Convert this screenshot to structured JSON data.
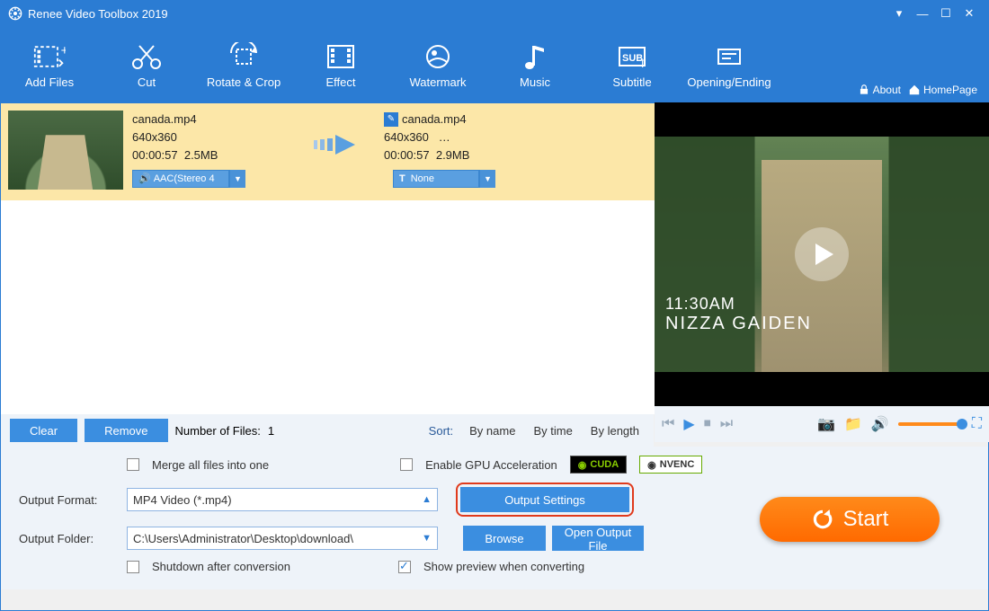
{
  "app": {
    "title": "Renee Video Toolbox 2019"
  },
  "header_links": {
    "about": "About",
    "homepage": "HomePage"
  },
  "toolbar": [
    {
      "id": "add-files",
      "label": "Add Files"
    },
    {
      "id": "cut",
      "label": "Cut"
    },
    {
      "id": "rotate-crop",
      "label": "Rotate & Crop"
    },
    {
      "id": "effect",
      "label": "Effect"
    },
    {
      "id": "watermark",
      "label": "Watermark"
    },
    {
      "id": "music",
      "label": "Music"
    },
    {
      "id": "subtitle",
      "label": "Subtitle"
    },
    {
      "id": "opening-ending",
      "label": "Opening/Ending"
    }
  ],
  "file": {
    "src": {
      "name": "canada.mp4",
      "resolution": "640x360",
      "duration": "00:00:57",
      "size": "2.5MB",
      "audio": "AAC(Stereo 4",
      "subtitle": "-"
    },
    "dst": {
      "name": "canada.mp4",
      "resolution": "640x360",
      "more": "…",
      "duration": "00:00:57",
      "size": "2.9MB",
      "subtitle_sel": "None"
    }
  },
  "listbar": {
    "clear": "Clear",
    "remove": "Remove",
    "count_label": "Number of Files:",
    "count": "1",
    "sort_label": "Sort:",
    "by_name": "By name",
    "by_time": "By time",
    "by_length": "By length"
  },
  "options": {
    "merge": "Merge all files into one",
    "gpu": "Enable GPU Acceleration",
    "cuda": "CUDA",
    "nvenc": "NVENC",
    "output_format_label": "Output Format:",
    "output_format_value": "MP4 Video (*.mp4)",
    "output_settings": "Output Settings",
    "output_folder_label": "Output Folder:",
    "output_folder_value": "C:\\Users\\Administrator\\Desktop\\download\\",
    "browse": "Browse",
    "open_output": "Open Output File",
    "shutdown": "Shutdown after conversion",
    "show_preview": "Show preview when converting",
    "start": "Start"
  },
  "preview": {
    "time": "11:30AM",
    "title": "NIZZA GAIDEN"
  }
}
